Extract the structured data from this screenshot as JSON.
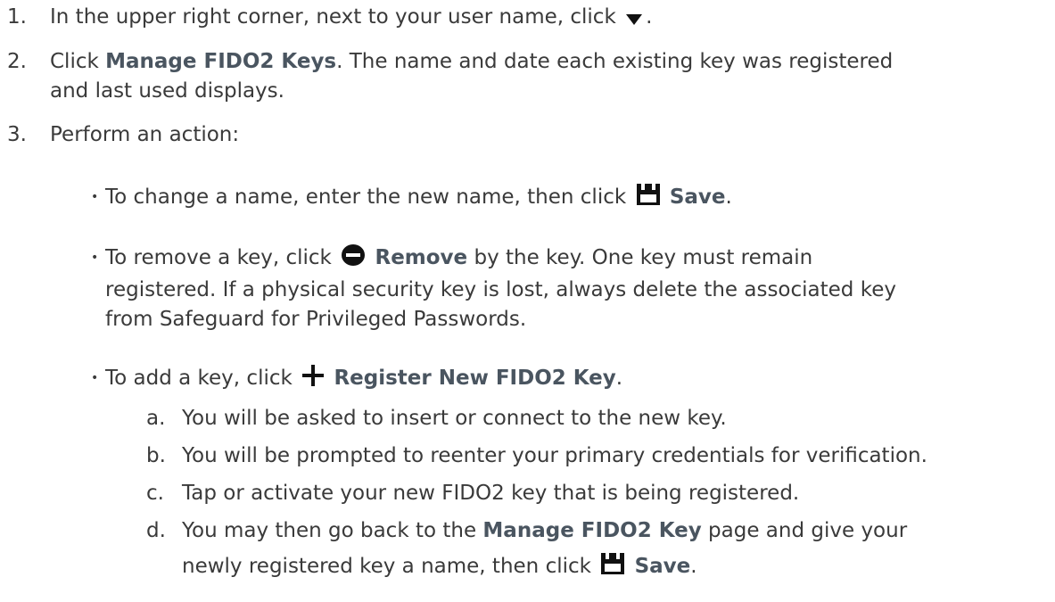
{
  "steps": [
    {
      "number": "1.",
      "text_before": "In the upper right corner, next to your user name, click",
      "text_after": ".",
      "icon": "dropdown-arrow-icon"
    },
    {
      "number": "2.",
      "prefix": "Click",
      "bold": "Manage FIDO2 Keys",
      "line1_rest": ". The name and date each existing key was registered",
      "line2": "and last used displays."
    },
    {
      "number": "3.",
      "text": "Perform an action:"
    }
  ],
  "bullets": [
    {
      "text_before": "To change a name, enter the new name, then click",
      "icon": "save-icon",
      "bold": "Save",
      "text_after": "."
    },
    {
      "text_before": "To remove a key, click",
      "icon": "remove-icon",
      "bold": "Remove",
      "line1_rest": "by the key. One key must remain",
      "line2": "registered. If a physical security key is lost, always delete the associated key",
      "line3": "from Safeguard for Privileged Passwords."
    },
    {
      "text_before": "To add a key, click",
      "icon": "plus-icon",
      "bold": "Register New FIDO2 Key",
      "text_after": "."
    }
  ],
  "substeps": [
    {
      "letter": "a.",
      "text": "You will be asked to insert or connect to the new key."
    },
    {
      "letter": "b.",
      "text": "You will be prompted to reenter your primary credentials for verification."
    },
    {
      "letter": "c.",
      "text": "Tap or activate your new FIDO2 key that is being registered."
    },
    {
      "letter": "d.",
      "text_before": "You may then go back to the",
      "bold": "Manage FIDO2 Key",
      "line1_rest": "page and give your",
      "line2_before": "newly registered key a name, then click",
      "icon": "save-icon",
      "bold2": "Save",
      "text_after": "."
    }
  ],
  "bullet_glyph": "•",
  "text_color": "#3a3a3a",
  "bold_color": "#4a5560"
}
